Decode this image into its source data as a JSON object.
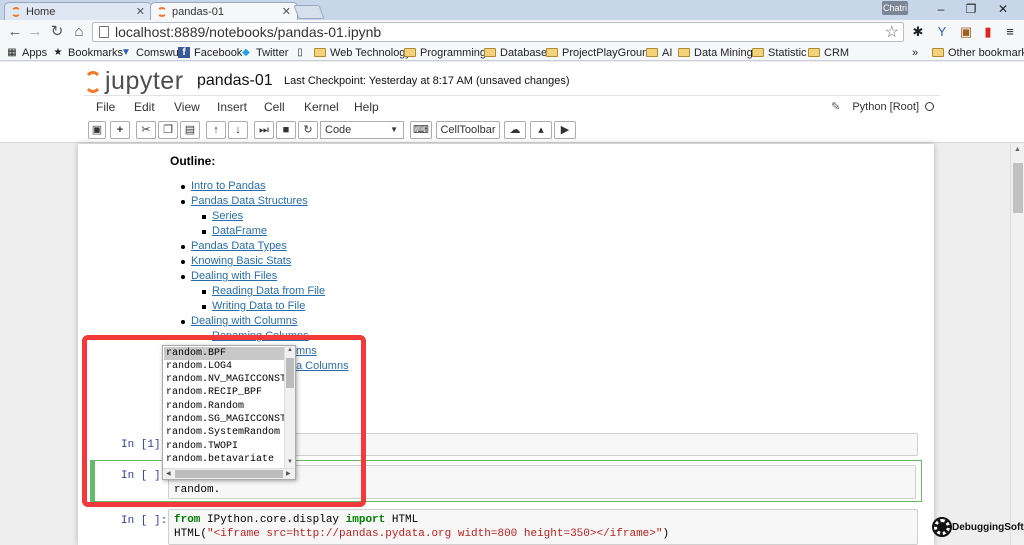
{
  "browser": {
    "tabs": [
      {
        "title": "Home",
        "active": false
      },
      {
        "title": "pandas-01",
        "active": true
      }
    ],
    "user_badge": "Chatri",
    "window_controls": [
      "–",
      "❐",
      "✕"
    ],
    "url": "localhost:8889/notebooks/pandas-01.ipynb",
    "bookmarks": [
      {
        "label": "Apps",
        "icon": "apps-grid-icon",
        "glyph": "▦"
      },
      {
        "label": "Bookmarks",
        "icon": "star-icon",
        "glyph": "★"
      },
      {
        "label": "Comswu",
        "icon": "comswu-icon",
        "glyph": "▼"
      },
      {
        "label": "Facebook",
        "icon": "facebook-icon",
        "glyph": "f"
      },
      {
        "label": "Twitter",
        "icon": "twitter-icon",
        "glyph": "🐦"
      },
      {
        "label": "",
        "icon": "page-icon",
        "glyph": "▯"
      },
      {
        "label": "Web Technology",
        "icon": "folder-icon"
      },
      {
        "label": "Programming",
        "icon": "folder-icon"
      },
      {
        "label": "Database",
        "icon": "folder-icon"
      },
      {
        "label": "ProjectPlayGrounD",
        "icon": "folder-icon"
      },
      {
        "label": "AI",
        "icon": "folder-icon"
      },
      {
        "label": "Data Mining",
        "icon": "folder-icon"
      },
      {
        "label": "Statistic",
        "icon": "folder-icon"
      },
      {
        "label": "CRM",
        "icon": "folder-icon"
      }
    ],
    "overflow": "»",
    "other_bookmarks": "Other bookmarks"
  },
  "jupyter": {
    "logo_text": "jupyter",
    "notebook_name": "pandas-01",
    "checkpoint": "Last Checkpoint: Yesterday at 8:17 AM (unsaved changes)",
    "menus": [
      "File",
      "Edit",
      "View",
      "Insert",
      "Cell",
      "Kernel",
      "Help"
    ],
    "kernel": "Python [Root]",
    "cell_type": "Code",
    "celltoolbar": "CellToolbar"
  },
  "outline": {
    "title": "Outline:",
    "items": [
      {
        "text": "Intro to Pandas",
        "level": 1
      },
      {
        "text": "Pandas Data Structures",
        "level": 1
      },
      {
        "text": "Series",
        "level": 2
      },
      {
        "text": "DataFrame",
        "level": 2
      },
      {
        "text": "Pandas Data Types",
        "level": 1
      },
      {
        "text": "Knowing Basic Stats",
        "level": 1
      },
      {
        "text": "Dealing with Files",
        "level": 1
      },
      {
        "text": "Reading Data from File",
        "level": 2
      },
      {
        "text": "Writing Data to File",
        "level": 2
      },
      {
        "text": "Dealing with Columns",
        "level": 1
      },
      {
        "text": "Renaming Columns",
        "level": 2
      }
    ],
    "partial_behind_popup": [
      "mns",
      "a Columns"
    ]
  },
  "cells": [
    {
      "prompt": "In [1]:",
      "code": ""
    },
    {
      "prompt": "In [ ]:",
      "code": "random."
    },
    {
      "prompt": "In [ ]:",
      "code_line1_kw1": "from",
      "code_line1_mod": " IPython.core.display ",
      "code_line1_kw2": "import",
      "code_line1_name": " HTML",
      "code_line2_fn": "HTML(",
      "code_line2_str": "\"<iframe src=http://pandas.pydata.org width=800 height=350></iframe>\"",
      "code_line2_end": ")"
    }
  ],
  "completer": {
    "items": [
      "random.BPF",
      "random.LOG4",
      "random.NV_MAGICCONST",
      "random.RECIP_BPF",
      "random.Random",
      "random.SG_MAGICCONST",
      "random.SystemRandom",
      "random.TWOPI",
      "random.betavariate"
    ],
    "selected_index": 0
  },
  "watermark": "DebuggingSoft",
  "colors": {
    "highlight": "#f23a3a",
    "link": "#296eaa",
    "jupyter_orange": "#f37726",
    "prompt": "#303f9f"
  }
}
